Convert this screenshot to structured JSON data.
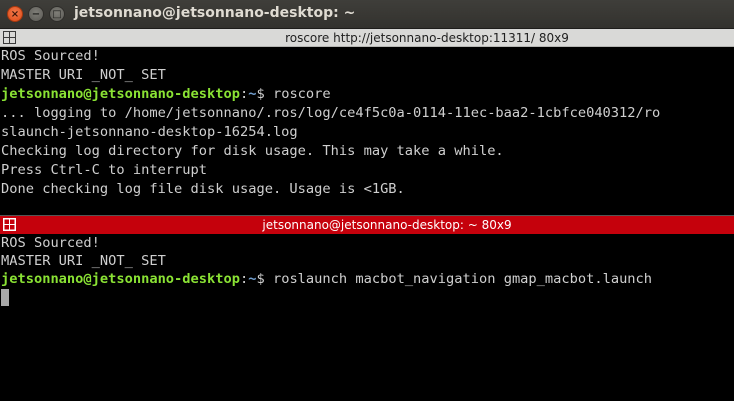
{
  "window": {
    "title": "jetsonnano@jetsonnano-desktop: ~",
    "close_glyph": "×",
    "minimize_glyph": "−",
    "maximize_glyph": "□"
  },
  "top_pane": {
    "title": "roscore http://jetsonnano-desktop:11311/ 80x9",
    "lines": {
      "l1": "ROS Sourced!",
      "l2": "MASTER URI _NOT_ SET",
      "prompt_user": "jetsonnano@jetsonnano-desktop",
      "prompt_sep": ":",
      "prompt_path": "~",
      "prompt_command": "$ roscore",
      "l4": "... logging to /home/jetsonnano/.ros/log/ce4f5c0a-0114-11ec-baa2-1cbfce040312/ro",
      "l5": "slaunch-jetsonnano-desktop-16254.log",
      "l6": "Checking log directory for disk usage. This may take a while.",
      "l7": "Press Ctrl-C to interrupt",
      "l8": "Done checking log file disk usage. Usage is <1GB."
    }
  },
  "bottom_pane": {
    "title": "jetsonnano@jetsonnano-desktop: ~ 80x9",
    "lines": {
      "l1": "ROS Sourced!",
      "l2": "MASTER URI _NOT_ SET",
      "prompt_user": "jetsonnano@jetsonnano-desktop",
      "prompt_sep": ":",
      "prompt_path": "~",
      "prompt_command": "$ roslaunch macbot_navigation gmap_macbot.launch"
    }
  },
  "colors": {
    "active_title_bg": "#c5010c",
    "inactive_title_bg": "#d9d9d7",
    "prompt_user": "#8ae234",
    "prompt_path": "#729fcf",
    "terminal_bg": "#000000",
    "terminal_fg": "#cfcfcf"
  },
  "icons": {
    "window_close": "close-icon",
    "pane_grid": "terminator-grid-icon"
  }
}
